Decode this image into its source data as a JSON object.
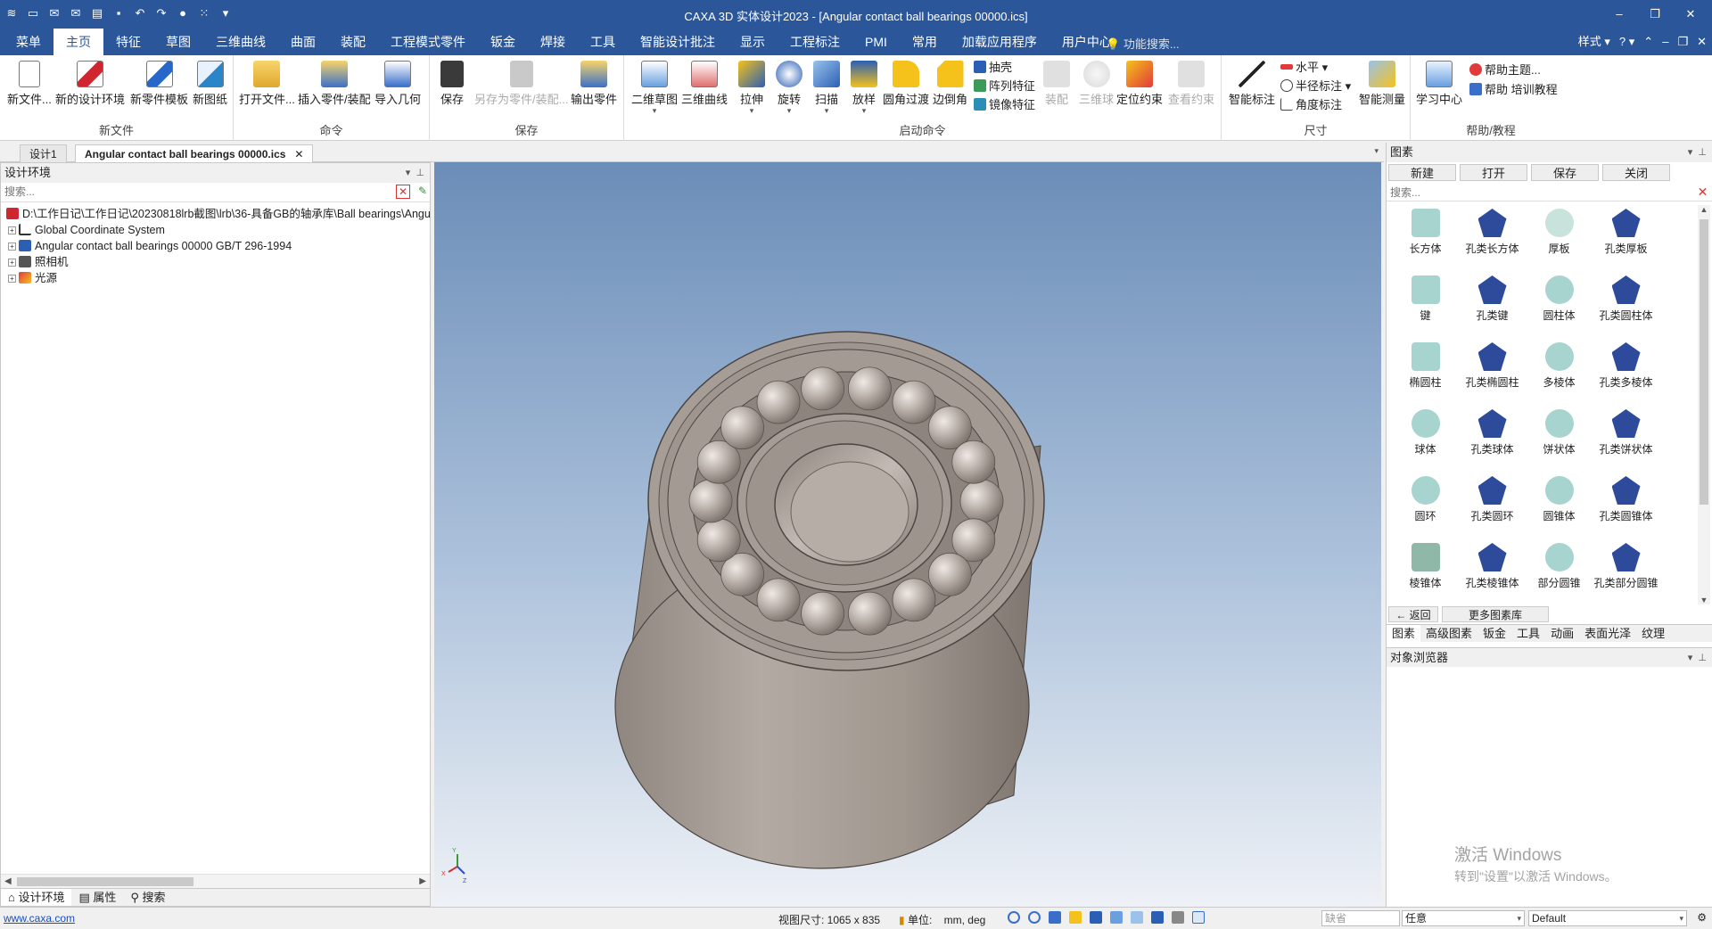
{
  "titlebar": {
    "title": "CAXA 3D 实体设计2023 - [Angular contact ball bearings 00000.ics]",
    "minimize": "–",
    "restore": "❐",
    "close": "✕"
  },
  "menu": {
    "tabs": [
      "菜单",
      "主页",
      "特征",
      "草图",
      "三维曲线",
      "曲面",
      "装配",
      "工程模式零件",
      "钣金",
      "焊接",
      "工具",
      "智能设计批注",
      "显示",
      "工程标注",
      "PMI",
      "常用",
      "加载应用程序",
      "用户中心"
    ],
    "active_tab": "主页",
    "search_placeholder": "功能搜索...",
    "style_label": "样式",
    "help_glyph": "?"
  },
  "ribbon": {
    "groups": {
      "new_file": "新文件",
      "command": "命令",
      "save": "保存",
      "launch": "启动命令",
      "dimension": "尺寸",
      "help": "帮助/教程"
    },
    "buttons": {
      "new_file": "新文件...",
      "new_design_env": "新的设计环境",
      "new_part_template": "新零件模板",
      "new_drawing": "新图纸",
      "open_file": "打开文件...",
      "insert_part": "插入零件/装配",
      "import_geometry": "导入几何",
      "save": "保存",
      "save_as_part": "另存为零件/装配...",
      "export_part": "输出零件",
      "sketch_2d": "二维草图",
      "curve_3d": "三维曲线",
      "extrude": "拉伸",
      "revolve": "旋转",
      "sweep": "扫描",
      "loft": "放样",
      "fillet": "圆角过渡",
      "chamfer": "边倒角",
      "shell": "抽壳",
      "pattern": "阵列特征",
      "mirror": "镜像特征",
      "assemble": "装配",
      "trackball": "三维球",
      "position_constraint": "定位约束",
      "view_constraint": "查看约束",
      "smart_dimension": "智能标注",
      "horizontal": "水平",
      "radius_dim": "半径标注",
      "angle_dim": "角度标注",
      "smart_measure": "智能测量",
      "learning_center": "学习中心",
      "help_topics": "帮助主题...",
      "help_training": "帮助 培训教程"
    }
  },
  "doc_tabs": [
    {
      "label": "设计1"
    },
    {
      "label": "Angular contact ball bearings 00000.ics"
    }
  ],
  "left_panel": {
    "title": "设计环境",
    "search_placeholder": "搜索...",
    "tree": [
      {
        "label": "D:\\工作日记\\工作日记\\20230818lrb截图\\lrb\\36-具备GB的轴承库\\Ball bearings\\Angular",
        "icon": "design-env-icon"
      },
      {
        "label": "Global Coordinate System",
        "icon": "coordinate-system-icon"
      },
      {
        "label": "Angular contact ball bearings 00000 GB/T 296-1994",
        "icon": "part-icon"
      },
      {
        "label": "照相机",
        "icon": "camera-icon"
      },
      {
        "label": "光源",
        "icon": "light-icon"
      }
    ],
    "bottom_tabs": [
      "设计环境",
      "属性",
      "搜索"
    ]
  },
  "right_panel": {
    "title": "图素",
    "toolbar": [
      "新建",
      "打开",
      "保存",
      "关闭"
    ],
    "search_placeholder": "搜索...",
    "palette": [
      {
        "label": "长方体",
        "color": "#a8d4cf"
      },
      {
        "label": "孔类长方体",
        "color": "#2e4a9a"
      },
      {
        "label": "厚板",
        "color": "#c8e2dc"
      },
      {
        "label": "孔类厚板",
        "color": "#2e4a9a"
      },
      {
        "label": "键",
        "color": "#a8d4cf"
      },
      {
        "label": "孔类键",
        "color": "#2e4a9a"
      },
      {
        "label": "圆柱体",
        "color": "#a8d4cf"
      },
      {
        "label": "孔类圆柱体",
        "color": "#2e4a9a"
      },
      {
        "label": "椭圆柱",
        "color": "#a8d4cf"
      },
      {
        "label": "孔类椭圆柱",
        "color": "#2e4a9a"
      },
      {
        "label": "多棱体",
        "color": "#a8d4cf"
      },
      {
        "label": "孔类多棱体",
        "color": "#2e4a9a"
      },
      {
        "label": "球体",
        "color": "#a8d4cf"
      },
      {
        "label": "孔类球体",
        "color": "#2e4a9a"
      },
      {
        "label": "饼状体",
        "color": "#a8d4cf"
      },
      {
        "label": "孔类饼状体",
        "color": "#2e4a9a"
      },
      {
        "label": "圆环",
        "color": "#a8d4cf"
      },
      {
        "label": "孔类圆环",
        "color": "#2e4a9a"
      },
      {
        "label": "圆锥体",
        "color": "#a8d4cf"
      },
      {
        "label": "孔类圆锥体",
        "color": "#2e4a9a"
      },
      {
        "label": "棱锥体",
        "color": "#8fb8a8"
      },
      {
        "label": "孔类棱锥体",
        "color": "#2e4a9a"
      },
      {
        "label": "部分圆锥",
        "color": "#a8d4cf"
      },
      {
        "label": "孔类部分圆锥",
        "color": "#2e4a9a"
      }
    ],
    "back_label": "返回",
    "more_label": "更多图素库",
    "bottom_tabs": [
      "图素",
      "高级图素",
      "钣金",
      "工具",
      "动画",
      "表面光泽",
      "纹理"
    ],
    "object_browser": "对象浏览器",
    "watermark_line1": "激活 Windows",
    "watermark_line2": "转到\"设置\"以激活 Windows。"
  },
  "statusbar": {
    "link": "www.caxa.com",
    "view_size": "视图尺寸: 1065 x  835",
    "unit_label": "单位:",
    "unit_value": "mm, deg",
    "field1_placeholder": "缺省",
    "field2": "任意",
    "field3": "Default"
  },
  "colors": {
    "title_bg": "#2b579a",
    "bearing": "#a49b94",
    "viewport_top": "#6b8db8"
  }
}
